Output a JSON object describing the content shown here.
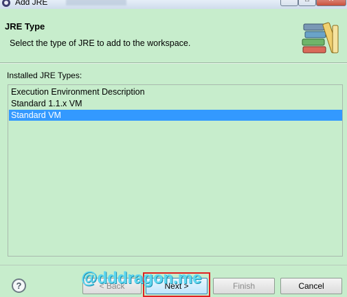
{
  "window": {
    "title": "Add JRE",
    "controls": {
      "minimize_icon": "minimize-icon",
      "maximize_icon": "maximize-icon",
      "close_icon": "close-icon"
    }
  },
  "header": {
    "heading": "JRE Type",
    "description": "Select the type of JRE to add to the workspace.",
    "banner_icon": "books-icon"
  },
  "installed": {
    "label": "Installed JRE Types:",
    "items": [
      {
        "label": "Execution Environment Description",
        "selected": false
      },
      {
        "label": "Standard 1.1.x VM",
        "selected": false
      },
      {
        "label": "Standard VM",
        "selected": true
      }
    ]
  },
  "footer": {
    "help_label": "?",
    "back_label": "< Back",
    "next_label": "Next >",
    "finish_label": "Finish",
    "cancel_label": "Cancel"
  },
  "watermark": "@dddragon.me",
  "colors": {
    "background": "#c7edcc",
    "selection": "#3399ff",
    "highlight_box": "#e02020",
    "watermark": "#5fd6ef"
  }
}
